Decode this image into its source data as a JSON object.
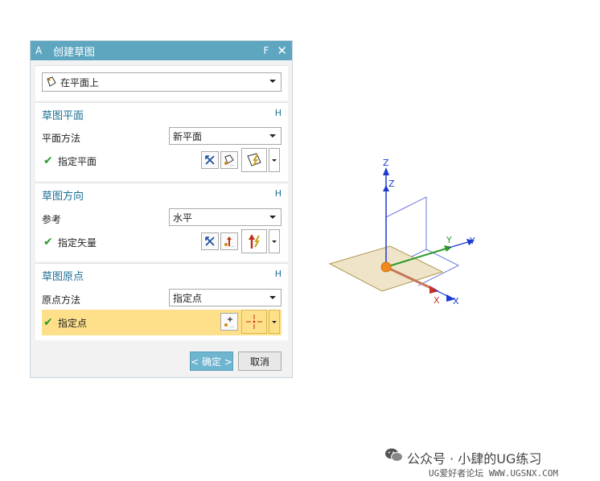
{
  "dialog": {
    "app_letter": "A",
    "title": "创建草图",
    "title_right_letter": "F",
    "sketch_type": "在平面上"
  },
  "sketch_plane": {
    "header": "草图平面",
    "collapse": "H",
    "method_label": "平面方法",
    "method_value": "新平面",
    "specify_label": "指定平面"
  },
  "sketch_orientation": {
    "header": "草图方向",
    "collapse": "H",
    "reference_label": "参考",
    "reference_value": "水平",
    "specify_label": "指定矢量"
  },
  "sketch_origin": {
    "header": "草图原点",
    "collapse": "H",
    "method_label": "原点方法",
    "method_value": "指定点",
    "specify_label": "指定点"
  },
  "footer": {
    "ok_label": "< 确定 >",
    "cancel_label": "取消"
  },
  "triad": {
    "z_label": "Z",
    "z_label2": "Z",
    "y_label": "Y",
    "y_label2": "Y",
    "x_label": "X",
    "x_label2": "X"
  },
  "watermark": {
    "line1": "公众号 · 小肆的UG练习",
    "line2": "UG爱好者论坛 WWW.UGSNX.COM"
  },
  "colors": {
    "titlebar": "#5ea5bf",
    "section_header": "#1c6f95",
    "highlight": "#ffe08a",
    "ok_button": "#6fb5cf"
  }
}
